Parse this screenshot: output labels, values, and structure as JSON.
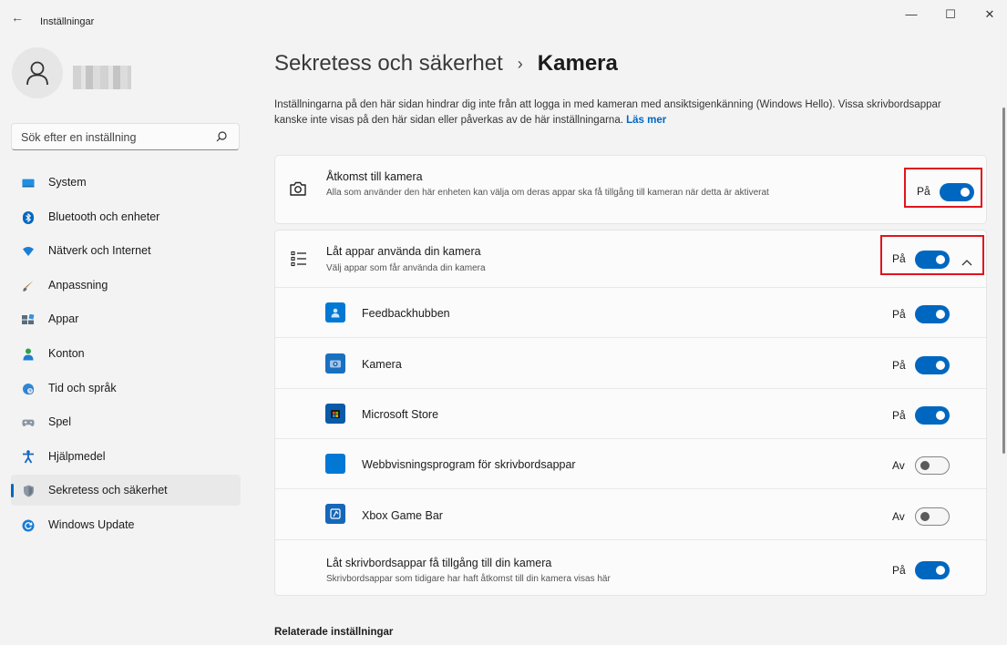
{
  "window": {
    "title": "Inställningar",
    "back_glyph": "←",
    "minimize_glyph": "—",
    "maximize_glyph": "☐",
    "close_glyph": "✕"
  },
  "sidebar": {
    "search_placeholder": "Sök efter en inställning",
    "items": [
      {
        "label": "System",
        "icon": "monitor-icon"
      },
      {
        "label": "Bluetooth och enheter",
        "icon": "bluetooth-icon"
      },
      {
        "label": "Nätverk och Internet",
        "icon": "wifi-icon"
      },
      {
        "label": "Anpassning",
        "icon": "brush-icon"
      },
      {
        "label": "Appar",
        "icon": "apps-icon"
      },
      {
        "label": "Konton",
        "icon": "person-icon"
      },
      {
        "label": "Tid och språk",
        "icon": "globe-clock-icon"
      },
      {
        "label": "Spel",
        "icon": "gamepad-icon"
      },
      {
        "label": "Hjälpmedel",
        "icon": "accessibility-icon"
      },
      {
        "label": "Sekretess och säkerhet",
        "icon": "shield-icon",
        "active": true
      },
      {
        "label": "Windows Update",
        "icon": "update-icon"
      }
    ]
  },
  "main": {
    "breadcrumb_parent": "Sekretess och säkerhet",
    "breadcrumb_sep": "›",
    "breadcrumb_current": "Kamera",
    "description": "Inställningarna på den här sidan hindrar dig inte från att logga in med kameran med ansiktsigenkänning (Windows Hello). Vissa skrivbordsappar kanske inte visas på den här sidan eller påverkas av de här inställningarna.",
    "learn_more": "Läs mer",
    "camera_access": {
      "title": "Åtkomst till kamera",
      "subtitle": "Alla som använder den här enheten kan välja om deras appar ska få tillgång till kameran när detta är aktiverat",
      "state": "På",
      "on": true
    },
    "let_apps": {
      "title": "Låt appar använda din kamera",
      "subtitle": "Välj appar som får använda din kamera",
      "state": "På",
      "on": true,
      "expanded_glyph": "^"
    },
    "apps": [
      {
        "name": "Feedbackhubben",
        "state": "På",
        "on": true,
        "color": "#0078d4"
      },
      {
        "name": "Kamera",
        "state": "På",
        "on": true,
        "color": "#1a6fbf"
      },
      {
        "name": "Microsoft Store",
        "state": "På",
        "on": true,
        "color": "#0a5aa8"
      },
      {
        "name": "Webbvisningsprogram för skrivbordsappar",
        "state": "Av",
        "on": false,
        "color": "#0078d4"
      },
      {
        "name": "Xbox Game Bar",
        "state": "Av",
        "on": false,
        "color": "#1667b8"
      }
    ],
    "desktop_apps": {
      "title": "Låt skrivbordsappar få tillgång till din kamera",
      "subtitle": "Skrivbordsappar som tidigare har haft åtkomst till din kamera visas här",
      "state": "På",
      "on": true
    },
    "related_heading": "Relaterade inställningar"
  },
  "colors": {
    "accent": "#0067c0",
    "highlight": "#e0141e"
  }
}
